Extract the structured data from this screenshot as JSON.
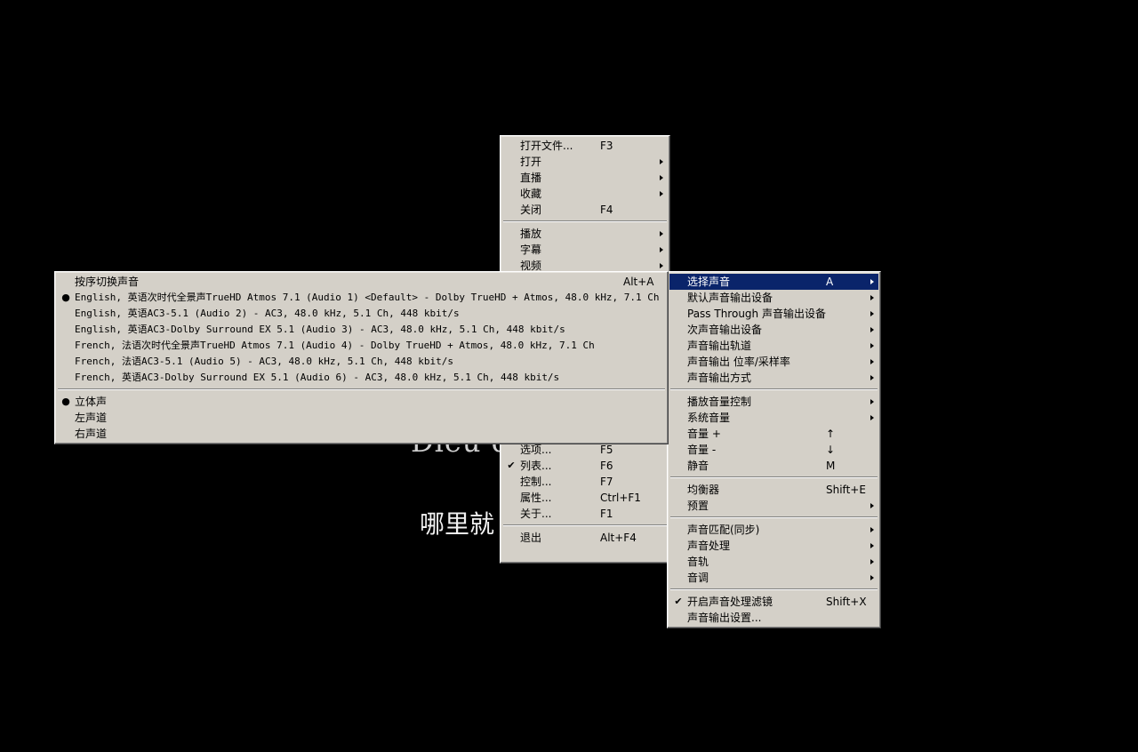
{
  "video": {
    "title_fragment": "Dieu d",
    "subtitle_fragment": "哪里就"
  },
  "main_menu": {
    "items": [
      {
        "label": "打开文件...",
        "shortcut": "F3"
      },
      {
        "label": "打开",
        "submenu": true
      },
      {
        "label": "直播",
        "submenu": true
      },
      {
        "label": "收藏",
        "submenu": true
      },
      {
        "label": "关闭",
        "shortcut": "F4"
      },
      {
        "separator": true
      },
      {
        "label": "播放",
        "submenu": true
      },
      {
        "label": "字幕",
        "submenu": true
      },
      {
        "label": "视频",
        "submenu": true
      }
    ],
    "lower_items": [
      {
        "label": "选项...",
        "shortcut": "F5"
      },
      {
        "label": "列表...",
        "shortcut": "F6",
        "checked": true
      },
      {
        "label": "控制...",
        "shortcut": "F7"
      },
      {
        "label": "属性...",
        "shortcut": "Ctrl+F1"
      },
      {
        "label": "关于...",
        "shortcut": "F1"
      },
      {
        "separator": true
      },
      {
        "label": "退出",
        "shortcut": "Alt+F4"
      }
    ]
  },
  "audio_menu": {
    "items": [
      {
        "label": "选择声音",
        "shortcut": "A",
        "submenu": true,
        "highlighted": true
      },
      {
        "label": "默认声音输出设备",
        "submenu": true
      },
      {
        "label": "Pass Through 声音输出设备",
        "submenu": true
      },
      {
        "label": "次声音输出设备",
        "submenu": true
      },
      {
        "label": "声音输出轨道",
        "submenu": true
      },
      {
        "label": "声音输出 位率/采样率",
        "submenu": true
      },
      {
        "label": "声音输出方式",
        "submenu": true
      },
      {
        "separator": true
      },
      {
        "label": "播放音量控制",
        "submenu": true
      },
      {
        "label": "系统音量",
        "submenu": true
      },
      {
        "label": "音量 +",
        "shortcut": "↑"
      },
      {
        "label": "音量 -",
        "shortcut": "↓"
      },
      {
        "label": "静音",
        "shortcut": "M"
      },
      {
        "separator": true
      },
      {
        "label": "均衡器",
        "shortcut": "Shift+E"
      },
      {
        "label": "预置",
        "submenu": true
      },
      {
        "separator": true
      },
      {
        "label": "声音匹配(同步)",
        "submenu": true
      },
      {
        "label": "声音处理",
        "submenu": true
      },
      {
        "label": "音轨",
        "submenu": true
      },
      {
        "label": "音调",
        "submenu": true
      },
      {
        "separator": true
      },
      {
        "label": "开启声音处理滤镜",
        "shortcut": "Shift+X",
        "checked": true
      },
      {
        "label": "声音输出设置..."
      }
    ]
  },
  "track_menu": {
    "items": [
      {
        "label": "按序切换声音",
        "shortcut": "Alt+A",
        "cjk": true
      },
      {
        "label": "English, 英语次时代全景声TrueHD Atmos 7.1 (Audio 1) <Default> - Dolby TrueHD + Atmos, 48.0 kHz, 7.1 Ch",
        "bullet": true
      },
      {
        "label": "English, 英语AC3-5.1 (Audio 2) - AC3, 48.0 kHz, 5.1 Ch, 448 kbit/s"
      },
      {
        "label": "English, 英语AC3-Dolby Surround EX 5.1 (Audio 3) - AC3, 48.0 kHz, 5.1 Ch, 448 kbit/s"
      },
      {
        "label": "French, 法语次时代全景声TrueHD Atmos 7.1 (Audio 4) - Dolby TrueHD + Atmos, 48.0 kHz, 7.1 Ch"
      },
      {
        "label": "French, 法语AC3-5.1 (Audio 5) - AC3, 48.0 kHz, 5.1 Ch, 448 kbit/s"
      },
      {
        "label": "French, 英语AC3-Dolby Surround EX 5.1 (Audio 6) - AC3, 48.0 kHz, 5.1 Ch, 448 kbit/s"
      },
      {
        "separator": true
      },
      {
        "label": "立体声",
        "bullet": true,
        "cjk": true
      },
      {
        "label": "左声道",
        "cjk": true
      },
      {
        "label": "右声道",
        "cjk": true
      }
    ]
  }
}
